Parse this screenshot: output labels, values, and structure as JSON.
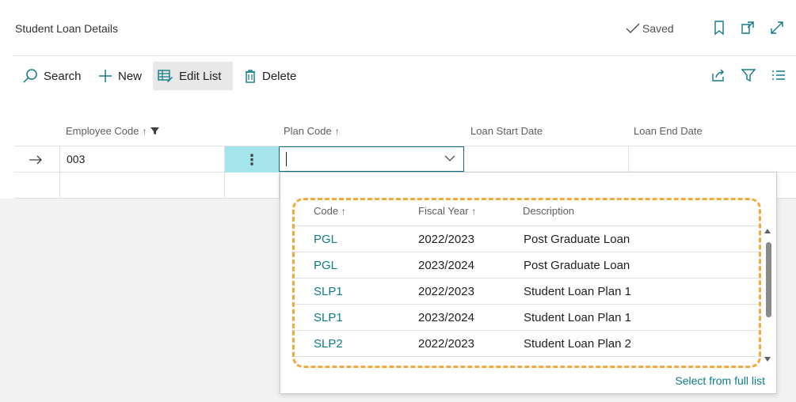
{
  "header": {
    "title": "Student Loan Details",
    "saved_label": "Saved",
    "icons": [
      "bookmark-icon",
      "open-new-window-icon",
      "expand-icon"
    ]
  },
  "actions": {
    "search_label": "Search",
    "new_label": "New",
    "edit_list_label": "Edit List",
    "delete_label": "Delete",
    "right_icons": [
      "share-icon",
      "filter-icon",
      "list-view-icon"
    ]
  },
  "columns": {
    "employee_code": "Employee Code",
    "plan_code": "Plan Code",
    "loan_start_date": "Loan Start Date",
    "loan_end_date": "Loan End Date"
  },
  "current_row": {
    "employee_code": "003",
    "plan_code_value": ""
  },
  "lookup": {
    "headers": {
      "code": "Code",
      "fiscal_year": "Fiscal Year",
      "description": "Description"
    },
    "rows": [
      {
        "code": "PGL",
        "fiscal_year": "2022/2023",
        "description": "Post Graduate Loan"
      },
      {
        "code": "PGL",
        "fiscal_year": "2023/2024",
        "description": "Post Graduate Loan"
      },
      {
        "code": "SLP1",
        "fiscal_year": "2022/2023",
        "description": "Student Loan Plan 1"
      },
      {
        "code": "SLP1",
        "fiscal_year": "2023/2024",
        "description": "Student Loan Plan 1"
      },
      {
        "code": "SLP2",
        "fiscal_year": "2022/2023",
        "description": "Student Loan Plan 2"
      }
    ],
    "select_full_list_label": "Select from full list"
  },
  "colors": {
    "accent": "#0f7b88",
    "selected_cell": "#a6e4ec",
    "highlight": "#f3a93b"
  }
}
